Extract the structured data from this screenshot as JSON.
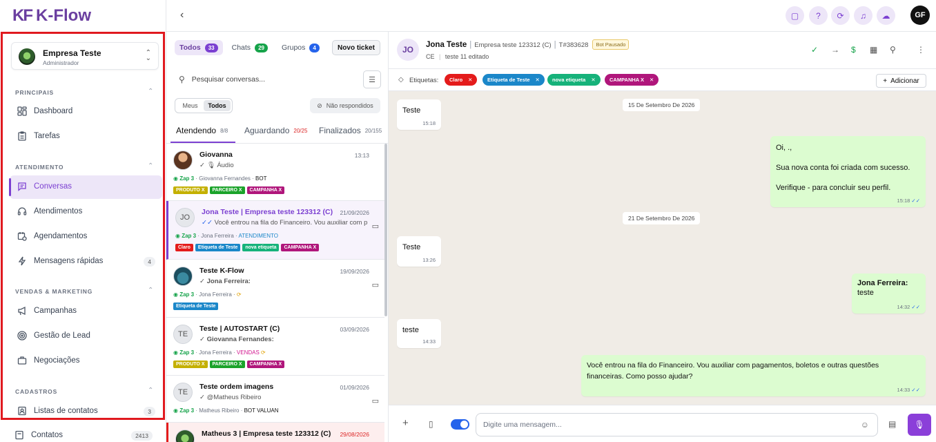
{
  "brand": {
    "logo_mark": "KF",
    "logo_text": "K-Flow",
    "color": "#6b3fa0"
  },
  "company": {
    "name": "Empresa Teste",
    "role": "Administrador"
  },
  "sidebar": {
    "sections": [
      {
        "title": "PRINCIPAIS",
        "items": [
          {
            "label": "Dashboard",
            "icon": "dashboard-icon"
          },
          {
            "label": "Tarefas",
            "icon": "clipboard-icon"
          }
        ]
      },
      {
        "title": "ATENDIMENTO",
        "items": [
          {
            "label": "Conversas",
            "icon": "chat-icon",
            "active": true
          },
          {
            "label": "Atendimentos",
            "icon": "headset-icon"
          },
          {
            "label": "Agendamentos",
            "icon": "calendar-clock-icon"
          },
          {
            "label": "Mensagens rápidas",
            "icon": "lightning-icon",
            "count": "4"
          }
        ]
      },
      {
        "title": "VENDAS & MARKETING",
        "items": [
          {
            "label": "Campanhas",
            "icon": "megaphone-icon"
          },
          {
            "label": "Gestão de Lead",
            "icon": "target-icon"
          },
          {
            "label": "Negociações",
            "icon": "briefcase-icon"
          }
        ]
      },
      {
        "title": "CADASTROS",
        "items": [
          {
            "label": "Listas de contatos",
            "icon": "contact-book-icon",
            "count": "3"
          },
          {
            "label": "Contatos",
            "icon": "contacts-icon",
            "count": "2413"
          }
        ]
      }
    ]
  },
  "topbar": {
    "avatar": "GF"
  },
  "list": {
    "tabs": [
      {
        "label": "Todos",
        "count": "33",
        "color": "#7b3fd1"
      },
      {
        "label": "Chats",
        "count": "29",
        "color": "#16a34a"
      },
      {
        "label": "Grupos",
        "count": "4",
        "color": "#2563eb"
      }
    ],
    "new_ticket": "Novo ticket",
    "search_placeholder": "Pesquisar conversas...",
    "seg": [
      "Meus",
      "Todos"
    ],
    "no_reply": "Não respondidos",
    "status_tabs": [
      {
        "label": "Atendendo",
        "count": "8/8"
      },
      {
        "label": "Aguardando",
        "count": "20/25"
      },
      {
        "label": "Finalizados",
        "count": "20/155"
      }
    ],
    "conversations": [
      {
        "name": "Giovanna",
        "date": "13:13",
        "msg": "Áudio",
        "meta_zap": "Zap 3",
        "meta_user": "Giovanna Fernandes",
        "meta_status": "BOT",
        "tags": [
          {
            "t": "PRODUTO X",
            "c": "#c4b000"
          },
          {
            "t": "PARCEIRO X",
            "c": "#1ba32a"
          },
          {
            "t": "CAMPANHA X",
            "c": "#b0167b"
          }
        ]
      },
      {
        "name": "Jona Teste | Empresa teste 123312 (C)",
        "date": "21/09/2026",
        "msg": "Você entrou na fila do Financeiro. Vou auxiliar com p...",
        "avatar": "JO",
        "meta_zap": "Zap 3",
        "meta_user": "Jona Ferreira",
        "meta_status": "ATENDIMENTO",
        "tags": [
          {
            "t": "Claro",
            "c": "#e41b1b"
          },
          {
            "t": "Etiqueta de Teste",
            "c": "#1b87c9"
          },
          {
            "t": "nova etiqueta",
            "c": "#16b27a"
          },
          {
            "t": "CAMPANHA X",
            "c": "#b0167b"
          }
        ]
      },
      {
        "name": "Teste K-Flow",
        "date": "19/09/2026",
        "msg": "Jona Ferreira:",
        "meta_zap": "Zap 3",
        "meta_user": "Jona Ferreira",
        "meta_status": "",
        "tags": [
          {
            "t": "Etiqueta de Teste",
            "c": "#1b87c9"
          }
        ]
      },
      {
        "name": "Teste | AUTOSTART (C)",
        "date": "03/09/2026",
        "msg": "Giovanna Fernandes:",
        "avatar": "TE",
        "meta_zap": "Zap 3",
        "meta_user": "Jona Ferreira",
        "meta_status": "VENDAS",
        "tags": [
          {
            "t": "PRODUTO X",
            "c": "#c4b000"
          },
          {
            "t": "PARCEIRO X",
            "c": "#1ba32a"
          },
          {
            "t": "CAMPANHA X",
            "c": "#b0167b"
          }
        ]
      },
      {
        "name": "Teste ordem imagens",
        "date": "01/09/2026",
        "msg": "@Matheus Ribeiro",
        "avatar": "TE",
        "meta_zap": "Zap 3",
        "meta_user": "Matheus Ribeiro",
        "meta_status": "BOT VALUAN",
        "tags": []
      },
      {
        "name": "Matheus 3 | Empresa teste 123312 (C)",
        "date": "29/08/2026",
        "msg": "",
        "meta_zap": "",
        "meta_user": "",
        "meta_status": "",
        "tags": []
      }
    ]
  },
  "chat": {
    "avatar": "JO",
    "name": "Jona Teste",
    "company": "Empresa teste 123312 (C)",
    "ticket": "T#383628",
    "bot": "Bot Pausado",
    "sub_state": "CE",
    "sub_edit": "teste 11 editado",
    "labels_title": "Etiquetas:",
    "labels": [
      {
        "t": "Claro",
        "c": "#e41b1b"
      },
      {
        "t": "Etiqueta de Teste",
        "c": "#1b87c9"
      },
      {
        "t": "nova etiqueta",
        "c": "#16b27a"
      },
      {
        "t": "CAMPANHA X",
        "c": "#b0167b"
      }
    ],
    "add_label": "Adicionar",
    "dates": [
      "15 De Setembro De 2026",
      "21 De Setembro De 2026"
    ],
    "messages": [
      {
        "dir": "in",
        "text": "Teste",
        "time": "15:18"
      },
      {
        "dir": "out",
        "l1": "Oi, .,",
        "l2": "Sua nova conta foi criada com sucesso.",
        "l3": "Verifique - para concluir seu perfil.",
        "time": "15:18"
      },
      {
        "dir": "in",
        "text": "Teste",
        "time": "13:26"
      },
      {
        "dir": "out",
        "sender": "Jona Ferreira:",
        "text": "teste",
        "time": "14:32"
      },
      {
        "dir": "in",
        "text": "teste",
        "time": "14:33"
      },
      {
        "dir": "out",
        "l1": "Você entrou na fila do Financeiro. Vou auxiliar com pagamentos, boletos e outras questões",
        "l2": "financeiras. Como posso ajudar?",
        "time": "14:33"
      }
    ],
    "composer_placeholder": "Digite uma mensagem..."
  }
}
